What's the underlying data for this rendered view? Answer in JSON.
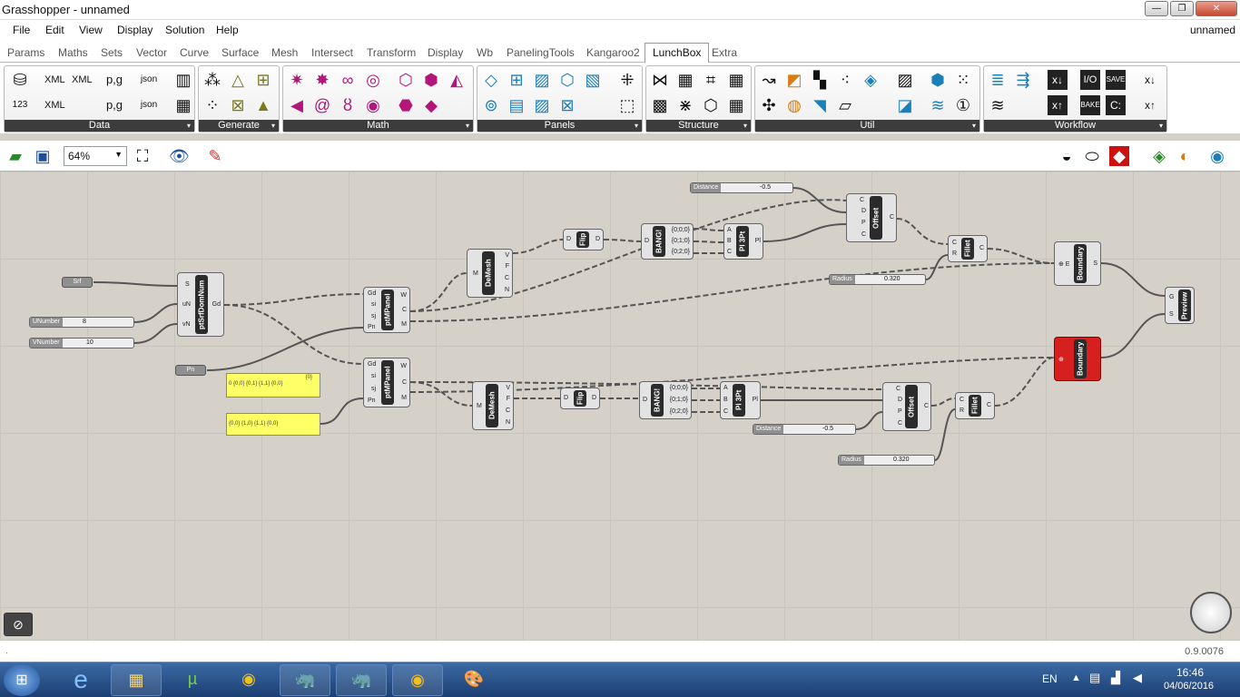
{
  "window": {
    "title": "Grasshopper - unnamed",
    "document": "unnamed",
    "min": "—",
    "max": "❐",
    "close": "✕"
  },
  "menu": [
    "File",
    "Edit",
    "View",
    "Display",
    "Solution",
    "Help"
  ],
  "tabs": [
    "Params",
    "Maths",
    "Sets",
    "Vector",
    "Curve",
    "Surface",
    "Mesh",
    "Intersect",
    "Transform",
    "Display",
    "Wb",
    "PanelingTools",
    "Kangaroo2",
    "LunchBox",
    "Extra"
  ],
  "active_tab": "LunchBox",
  "ribbon": {
    "panels": [
      "Data",
      "Generate",
      "Math",
      "Panels",
      "Structure",
      "Util",
      "Workflow"
    ]
  },
  "toolbar": {
    "zoom": "64%"
  },
  "components": {
    "srf": "Srf",
    "unumber_label": "UNumber",
    "unumber_value": "8",
    "vnumber_label": "VNumber",
    "vnumber_value": "10",
    "pn": "Pn",
    "ptsrfdomnum": "ptSrfDomNum",
    "ptmpanel": "ptMPanel",
    "demesh": "DeMesh",
    "flip": "Flip",
    "bang": "BANG!",
    "pl3pt": "Pl 3Pt",
    "offset": "Offset",
    "fillet": "Fillet",
    "boundary": "Boundary",
    "preview": "Preview",
    "distance_label": "Distance",
    "distance_value": "-0.5",
    "radius_label": "Radius",
    "radius_value": "0.320",
    "panel1_top": "{0}",
    "panel1_text": "0 {0,0} {0,1} {1,1} {0,0}",
    "panel2_text": "{0,0} {1,0} {1,1} {0,0}",
    "bang_out1": "{0;0;0}",
    "bang_out2": "{0;1;0}",
    "bang_out3": "{0;2;0}"
  },
  "status": {
    "version": "0.9.0076"
  },
  "taskbar": {
    "lang": "EN",
    "time": "16:46",
    "date": "04/06/2016"
  }
}
